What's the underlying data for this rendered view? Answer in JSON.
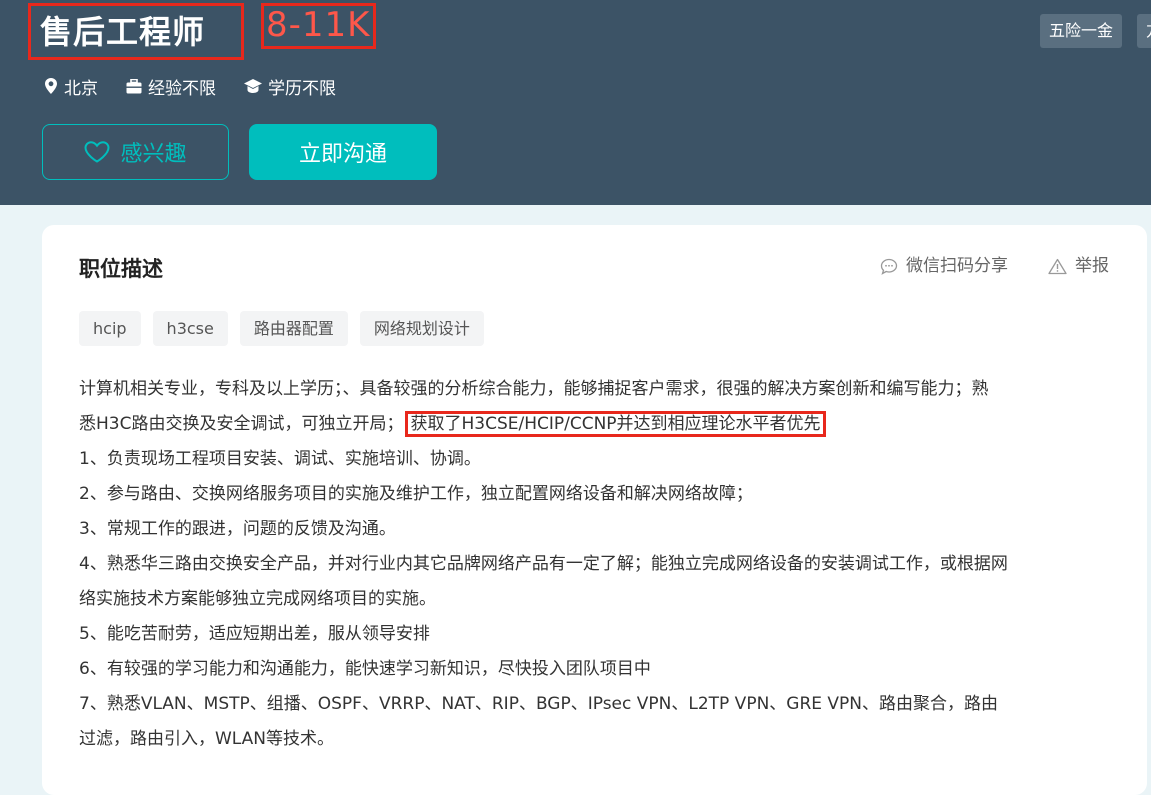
{
  "job": {
    "title": "售后工程师",
    "salary": "8-11K",
    "benefits": [
      "五险一金",
      "方"
    ],
    "location": "北京",
    "experience": "经验不限",
    "education": "学历不限"
  },
  "actions": {
    "interest_label": "感兴趣",
    "chat_label": "立即沟通"
  },
  "description": {
    "section_title": "职位描述",
    "share_label": "微信扫码分享",
    "report_label": "举报",
    "skills": [
      "hcip",
      "h3cse",
      "路由器配置",
      "网络规划设计"
    ],
    "lines": [
      "计算机相关专业，专科及以上学历；、具备较强的分析综合能力，能够捕捉客户需求，很强的解决方案创新和编写能力；熟",
      "悉H3C路由交换及安全调试，可独立开局；",
      "获取了H3CSE/HCIP/CCNP并达到相应理论水平者优先",
      "1、负责现场工程项目安装、调试、实施培训、协调。",
      "2、参与路由、交换网络服务项目的实施及维护工作，独立配置网络设备和解决网络故障；",
      "3、常规工作的跟进，问题的反馈及沟通。",
      "4、熟悉华三路由交换安全产品，并对行业内其它品牌网络产品有一定了解；能独立完成网络设备的安装调试工作，或根据网",
      "络实施技术方案能够独立完成网络项目的实施。",
      "5、能吃苦耐劳，适应短期出差，服从领导安排",
      "6、有较强的学习能力和沟通能力，能快速学习新知识，尽快投入团队项目中",
      "7、熟悉VLAN、MSTP、组播、OSPF、VRRP、NAT、RIP、BGP、IPsec VPN、L2TP VPN、GRE VPN、路由聚合，路由",
      "过滤，路由引入，WLAN等技术。"
    ]
  },
  "colors": {
    "header_bg": "#3c5366",
    "accent": "#00bebd",
    "salary": "#fe574a",
    "highlight_border": "#e8281c"
  }
}
